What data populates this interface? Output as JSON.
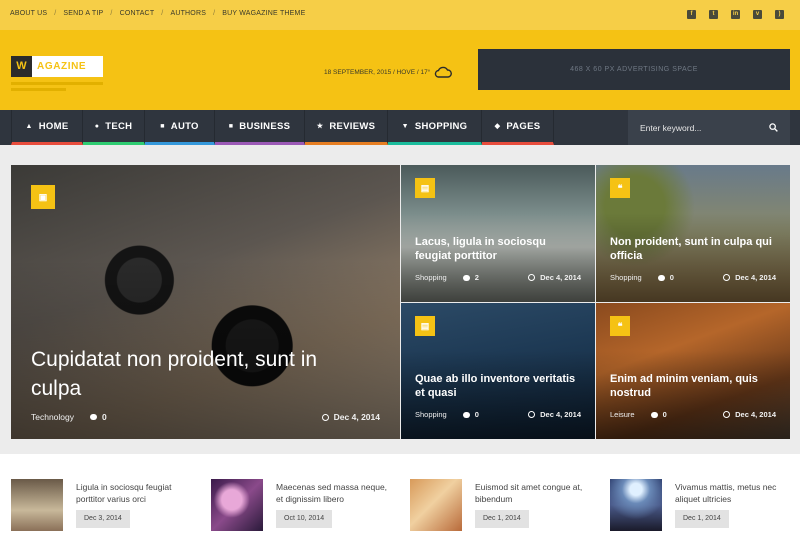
{
  "topbar": {
    "links": [
      "ABOUT US",
      "SEND A TIP",
      "CONTACT",
      "AUTHORS",
      "BUY WAGAZINE THEME"
    ],
    "social_icons": [
      "facebook-icon",
      "twitter-icon",
      "linkedin-icon",
      "vimeo-icon",
      "rss-icon"
    ]
  },
  "header": {
    "logo_mark": "W",
    "logo_text": "AGAZINE",
    "dateline": "18 SEPTEMBER, 2015 / HOVE / 17°",
    "weather_icon": "cloud-icon",
    "ad_text": "468 X 60 PX ADVERTISING SPACE"
  },
  "nav": {
    "items": [
      {
        "label": "HOME",
        "icon": "home-icon",
        "color": "#e74c3c"
      },
      {
        "label": "TECH",
        "icon": "bulb-icon",
        "color": "#2ecc71"
      },
      {
        "label": "AUTO",
        "icon": "car-icon",
        "color": "#3498db"
      },
      {
        "label": "BUSINESS",
        "icon": "briefcase-icon",
        "color": "#9b59b6"
      },
      {
        "label": "REVIEWS",
        "icon": "star-icon",
        "color": "#e67e22"
      },
      {
        "label": "SHOPPING",
        "icon": "cart-icon",
        "color": "#1abc9c"
      },
      {
        "label": "PAGES",
        "icon": "pages-icon",
        "color": "#e74c3c"
      }
    ],
    "search_placeholder": "Enter keyword..."
  },
  "featured": [
    {
      "title": "Cupidatat non proident, sunt in culpa",
      "category": "Technology",
      "comments": "0",
      "date": "Dec 4, 2014",
      "badge_icon": "image-icon"
    },
    {
      "title": "Lacus, ligula in sociosqu feugiat porttitor",
      "category": "Shopping",
      "comments": "2",
      "date": "Dec 4, 2014",
      "badge_icon": "film-icon"
    },
    {
      "title": "Non proident, sunt in culpa qui officia",
      "category": "Shopping",
      "comments": "0",
      "date": "Dec 4, 2014",
      "badge_icon": "quote-icon"
    },
    {
      "title": "Quae ab illo inventore veritatis et quasi",
      "category": "Shopping",
      "comments": "0",
      "date": "Dec 4, 2014",
      "badge_icon": "film-icon"
    },
    {
      "title": "Enim ad minim veniam, quis nostrud",
      "category": "Leisure",
      "comments": "0",
      "date": "Dec 4, 2014",
      "badge_icon": "quote-icon"
    }
  ],
  "latest": [
    {
      "title": "Ligula in sociosqu feugiat porttitor varius orci",
      "date": "Dec 3, 2014"
    },
    {
      "title": "Maecenas sed massa neque, et dignissim libero",
      "date": "Oct 10, 2014"
    },
    {
      "title": "Euismod sit amet congue at, bibendum",
      "date": "Dec 1, 2014"
    },
    {
      "title": "Vivamus mattis, metus nec aliquet ultricies",
      "date": "Dec 1, 2014"
    }
  ],
  "colors": {
    "accent": "#f5c214",
    "topbar": "#f6ce47",
    "nav": "#2f353e"
  }
}
